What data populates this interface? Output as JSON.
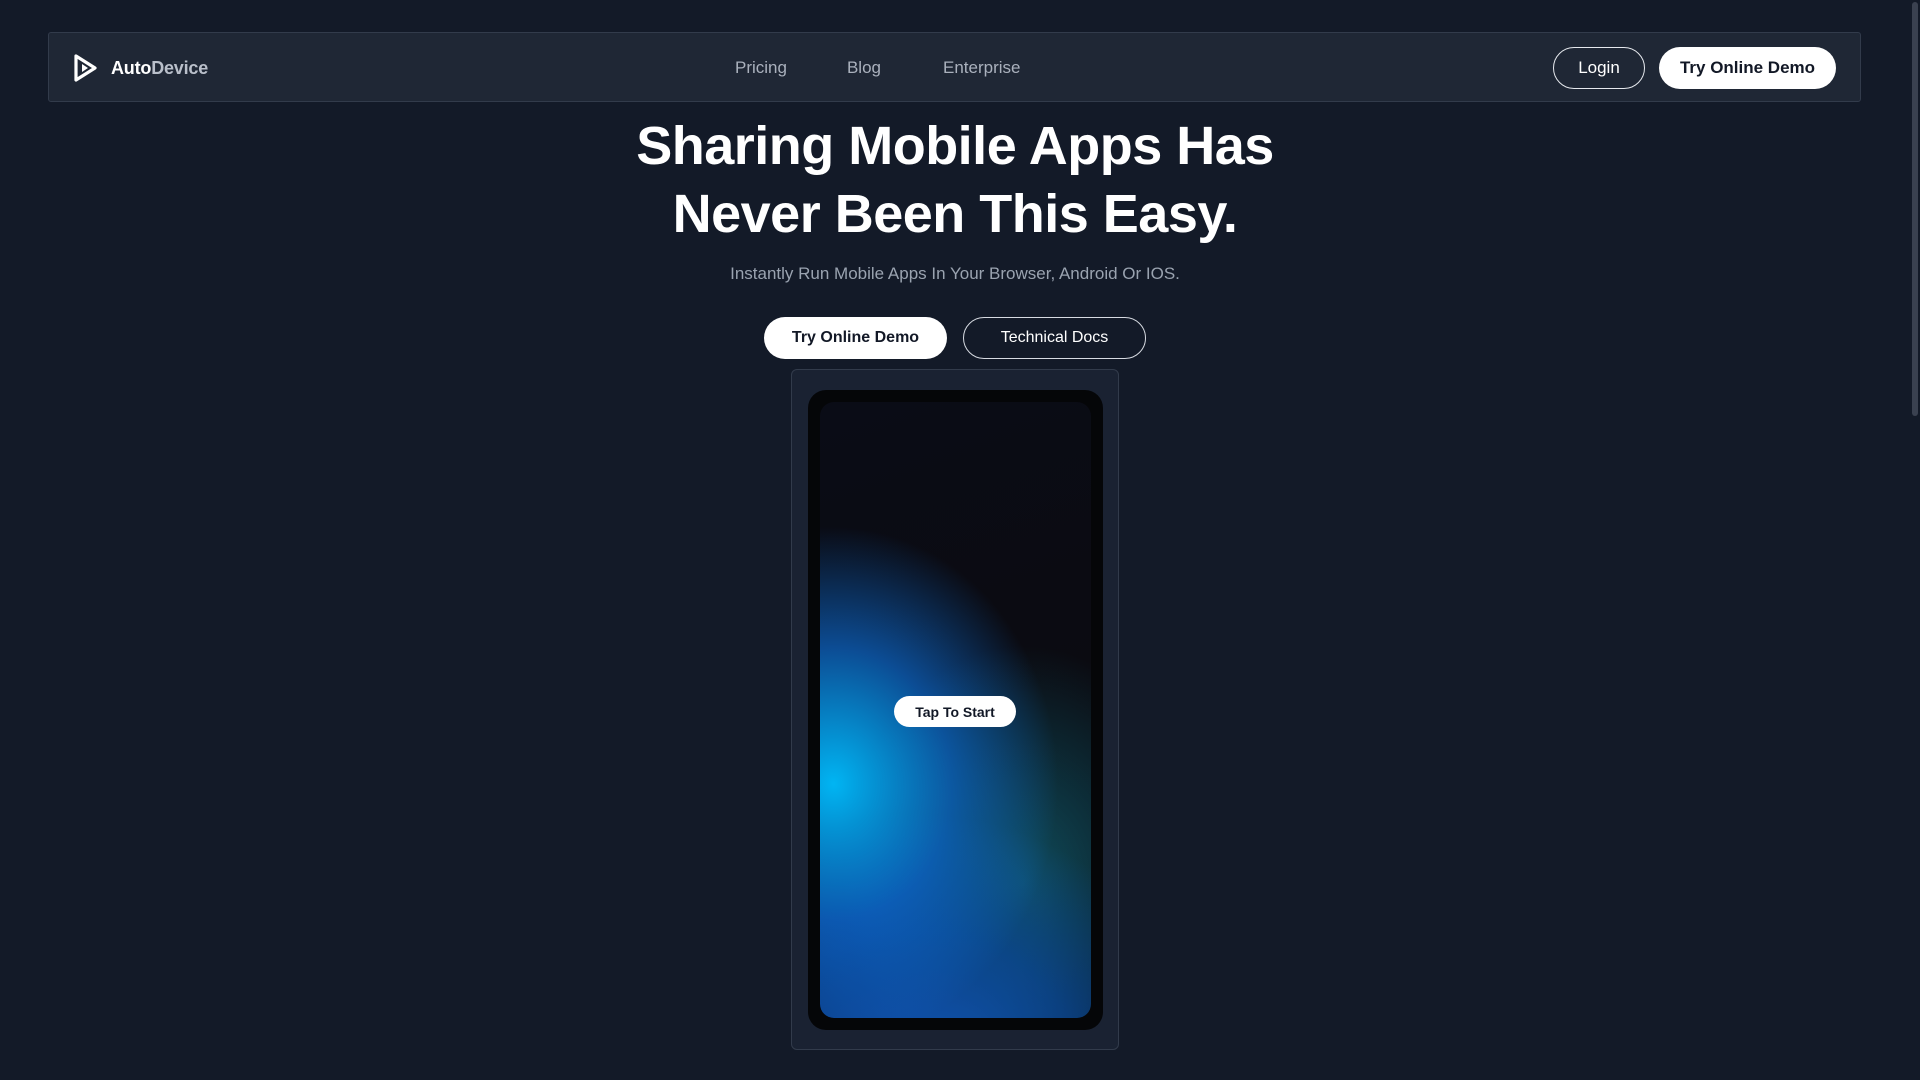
{
  "navbar": {
    "brand_part1": "Auto",
    "brand_part2": "Device",
    "links": [
      "Pricing",
      "Blog",
      "Enterprise"
    ],
    "login_label": "Login",
    "demo_label": "Try Online Demo"
  },
  "hero": {
    "title_line1": "Sharing Mobile Apps Has",
    "title_line2": "Never Been This Easy.",
    "subtitle": "Instantly Run Mobile Apps In Your Browser, Android Or IOS.",
    "demo_label": "Try Online Demo",
    "docs_label": "Technical Docs"
  },
  "device": {
    "tap_label": "Tap To Start"
  },
  "icons": {
    "logo": "autodevice-logo-icon"
  },
  "colors": {
    "background": "#131a28",
    "navbar_bg": "#1f2735",
    "accent_button": "#ffffff",
    "muted_text": "#9aa3b0",
    "screen_blue": "#00beff"
  }
}
